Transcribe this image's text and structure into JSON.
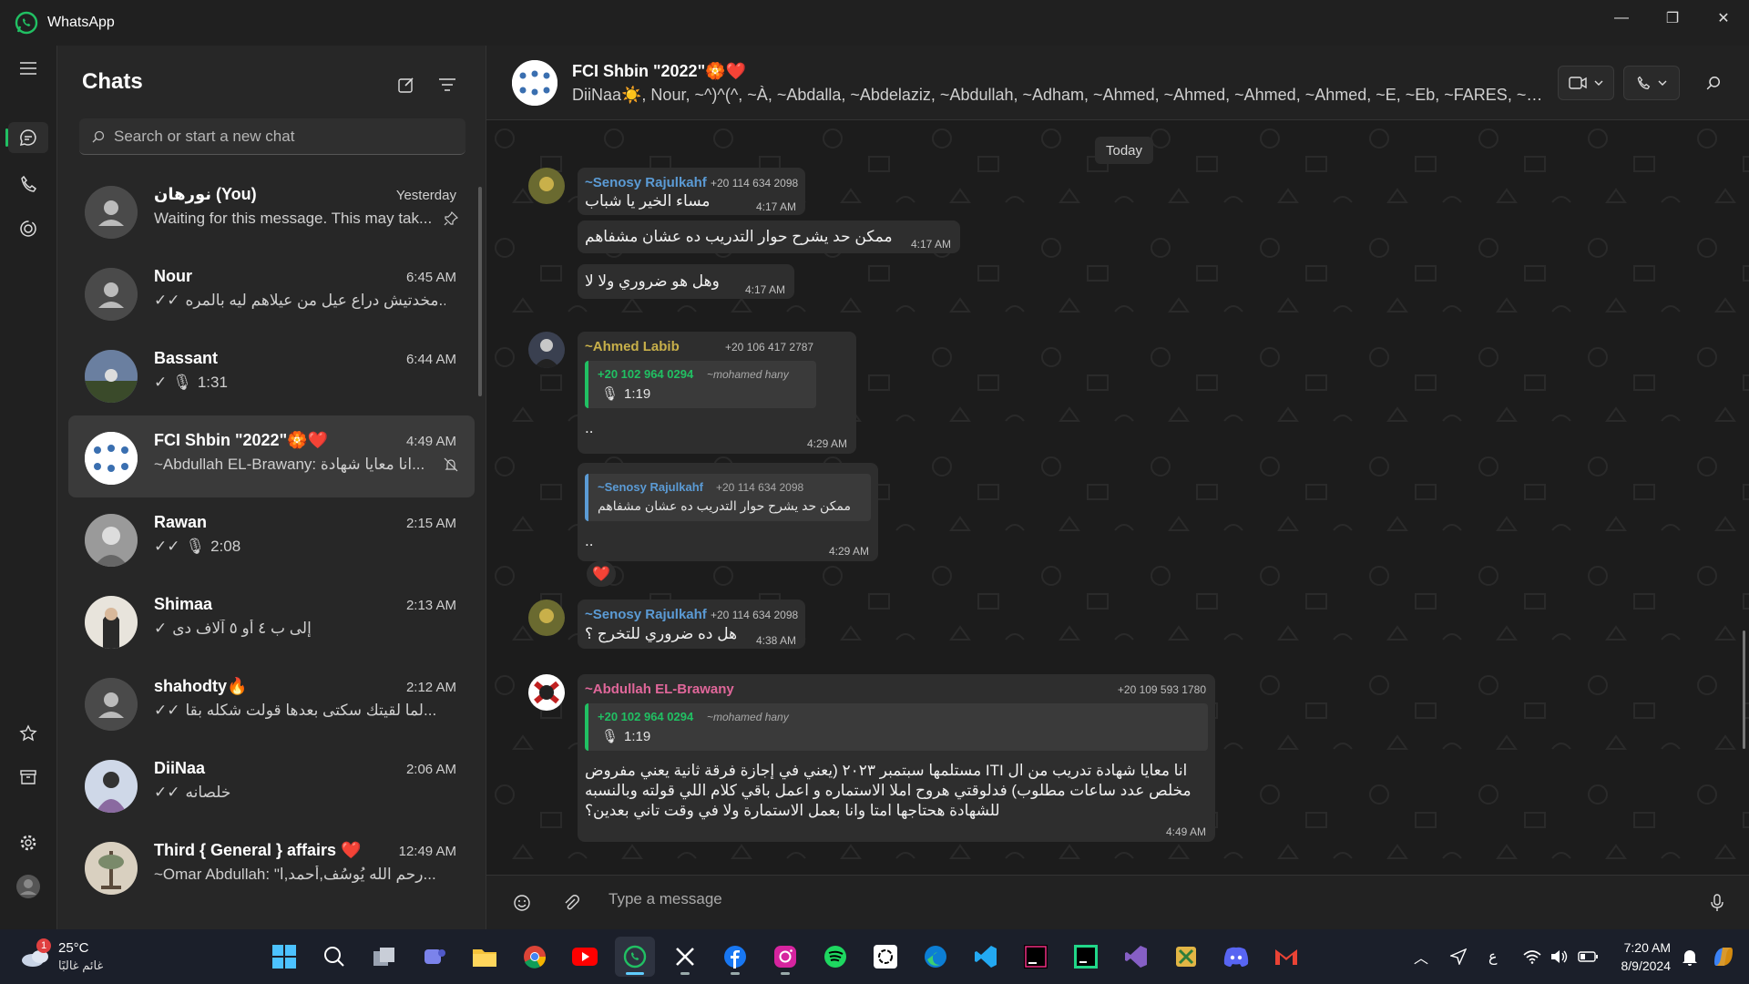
{
  "window": {
    "title": "WhatsApp",
    "controls": [
      "minimize",
      "restore",
      "close"
    ]
  },
  "rail": {
    "items": [
      "chats",
      "calls",
      "status"
    ],
    "bottom": [
      "starred",
      "archived",
      "settings",
      "profile"
    ]
  },
  "sidebar": {
    "heading": "Chats",
    "search_placeholder": "Search or start a new chat",
    "chats": [
      {
        "name": "نورهان (You)",
        "time": "Yesterday",
        "preview": "Waiting for this message. This may tak...",
        "status": "pinned"
      },
      {
        "name": "Nour",
        "time": "6:45 AM",
        "preview": "مخدتيش دراع عيل من عيلاهم ليه بالمره...",
        "status": "read"
      },
      {
        "name": "Bassant",
        "time": "6:44 AM",
        "preview": "1:31",
        "status": "voice"
      },
      {
        "name": "FCI Shbin \"2022\"🏵️❤️",
        "time": "4:49 AM",
        "preview": "~Abdullah EL-Brawany: انا معايا شهادة...",
        "status": "muted"
      },
      {
        "name": "Rawan",
        "time": "2:15 AM",
        "preview": "2:08",
        "status": "voice-read"
      },
      {
        "name": "Shimaa",
        "time": "2:13 AM",
        "preview": "إلى ب ٤ أو ٥ آلاف دى",
        "status": "sent"
      },
      {
        "name": "shahodty🔥",
        "time": "2:12 AM",
        "preview": "لما لقيتك سكتى بعدها قولت شكله بقا...",
        "status": "read"
      },
      {
        "name": "DiiNaa",
        "time": "2:06 AM",
        "preview": "خلصانه",
        "status": "read"
      },
      {
        "name": "Third { General } affairs ❤️",
        "time": "12:49 AM",
        "preview": "~Omar Abdullah: \"رحم الله يُوسُف,أحمد,ا...",
        "status": "group"
      }
    ]
  },
  "conversation": {
    "group_name": "FCI Shbin \"2022\"🏵️❤️",
    "members": "DiiNaa☀️, Nour, ~^)^(^, ~À, ~Abdalla, ~Abdelaziz, ~Abdullah, ~Adham, ~Ahmed, ~Ahmed, ~Ahmed, ~Ahmed, ~E, ~Eb, ~FARES, ~Geh...",
    "day": "Today",
    "composer_placeholder": "Type a message",
    "messages": {
      "m1": {
        "sender": "~Senosy Rajulkahf",
        "phone": "+20 114 634 2098",
        "text": "مساء الخير يا شباب",
        "time": "4:17 AM"
      },
      "m2": {
        "text": "ممكن حد يشرح حوار التدريب ده عشان مشفاهم",
        "time": "4:17 AM"
      },
      "m3": {
        "text": "وهل هو ضروري ولا لا",
        "time": "4:17 AM"
      },
      "m4": {
        "sender": "~Ahmed Labib",
        "phone": "+20 106 417 2787",
        "quote_phone": "+20 102 964 0294",
        "quote_name": "~mohamed hany",
        "quote_duration": "1:19",
        "text": "..",
        "time": "4:29 AM"
      },
      "m5": {
        "quote_sender": "~Senosy Rajulkahf",
        "quote_phone": "+20 114 634 2098",
        "quote_text": "ممكن حد يشرح حوار التدريب ده عشان مشفاهم",
        "text": "..",
        "time": "4:29 AM",
        "reaction": "❤️"
      },
      "m6": {
        "sender": "~Senosy Rajulkahf",
        "phone": "+20 114 634 2098",
        "text": "هل ده ضروري للتخرج ؟",
        "time": "4:38 AM"
      },
      "m7": {
        "sender": "~Abdullah EL-Brawany",
        "phone": "+20 109 593 1780",
        "quote_phone": "+20 102 964 0294",
        "quote_name": "~mohamed hany",
        "quote_duration": "1:19",
        "line1": "انا معايا شهادة تدريب من ال ITI مستلمها سبتمبر ٢٠٢٣ (يعني في إجازة فرقة ثانية يعني مفروض",
        "line2": "مخلص عدد ساعات مطلوب) فدلوقتي هروح املا الاستماره و اعمل باقي كلام اللي قولته وبالنسبه",
        "line3": "للشهادة هحتاجها امتا وانا بعمل الاستمارة ولا في وقت تاني بعدين؟",
        "time": "4:49 AM"
      }
    }
  },
  "taskbar": {
    "weather_temp": "25°C",
    "weather_condition": "غائم غالبًا",
    "weather_badge": "1",
    "apps": [
      "start",
      "search",
      "task-view",
      "teams",
      "file-explorer",
      "chrome",
      "youtube",
      "whatsapp",
      "x",
      "facebook",
      "instagram",
      "spotify",
      "chatgpt",
      "edge",
      "vscode",
      "jetbrains",
      "clion",
      "visual-studio",
      "snipping",
      "discord",
      "gmail"
    ],
    "lang": "ع",
    "time": "7:20 AM",
    "date": "8/9/2024"
  },
  "colors": {
    "accent": "#21c063",
    "senosy": "#5b9bd5",
    "labib": "#c8b04a",
    "abdullah": "#e0679a",
    "quote_blue": "#5b9bd5"
  }
}
